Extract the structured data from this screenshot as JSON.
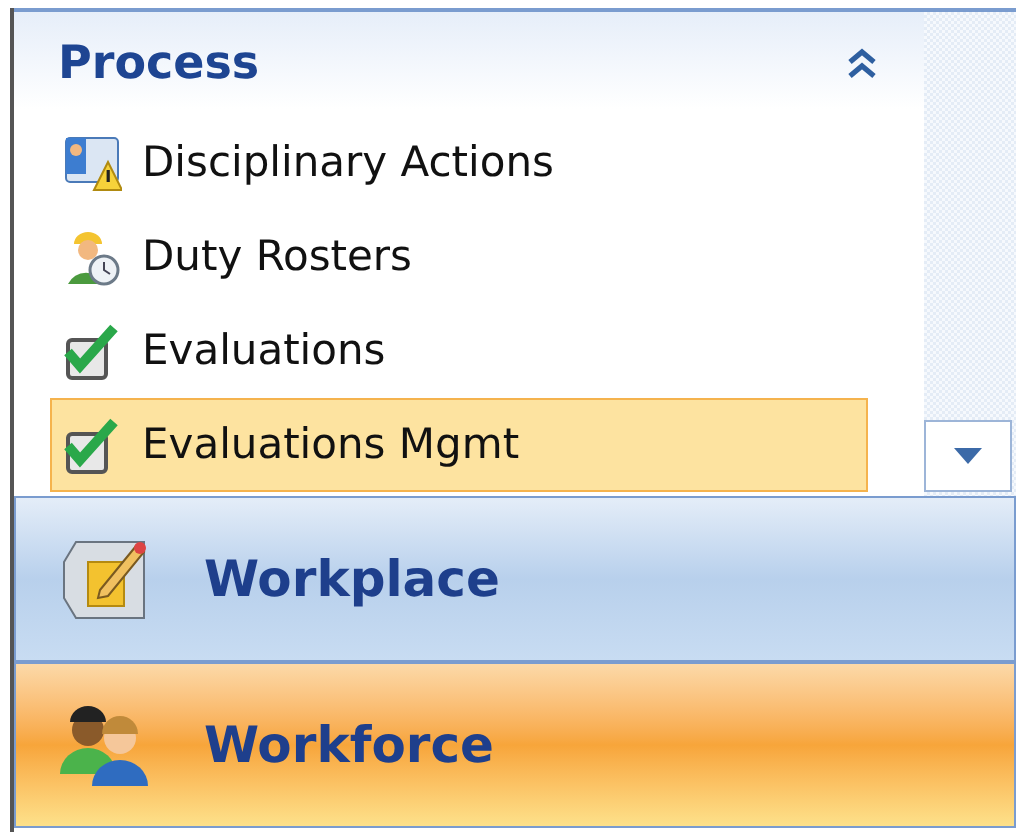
{
  "group": {
    "title": "Process",
    "expanded": true,
    "items": [
      {
        "label": "Disciplinary Actions",
        "selected": false
      },
      {
        "label": "Duty Rosters",
        "selected": false
      },
      {
        "label": "Evaluations",
        "selected": false
      },
      {
        "label": "Evaluations Mgmt",
        "selected": true
      }
    ]
  },
  "nav_buttons": [
    {
      "label": "Workplace",
      "selected": false
    },
    {
      "label": "Workforce",
      "selected": true
    }
  ]
}
